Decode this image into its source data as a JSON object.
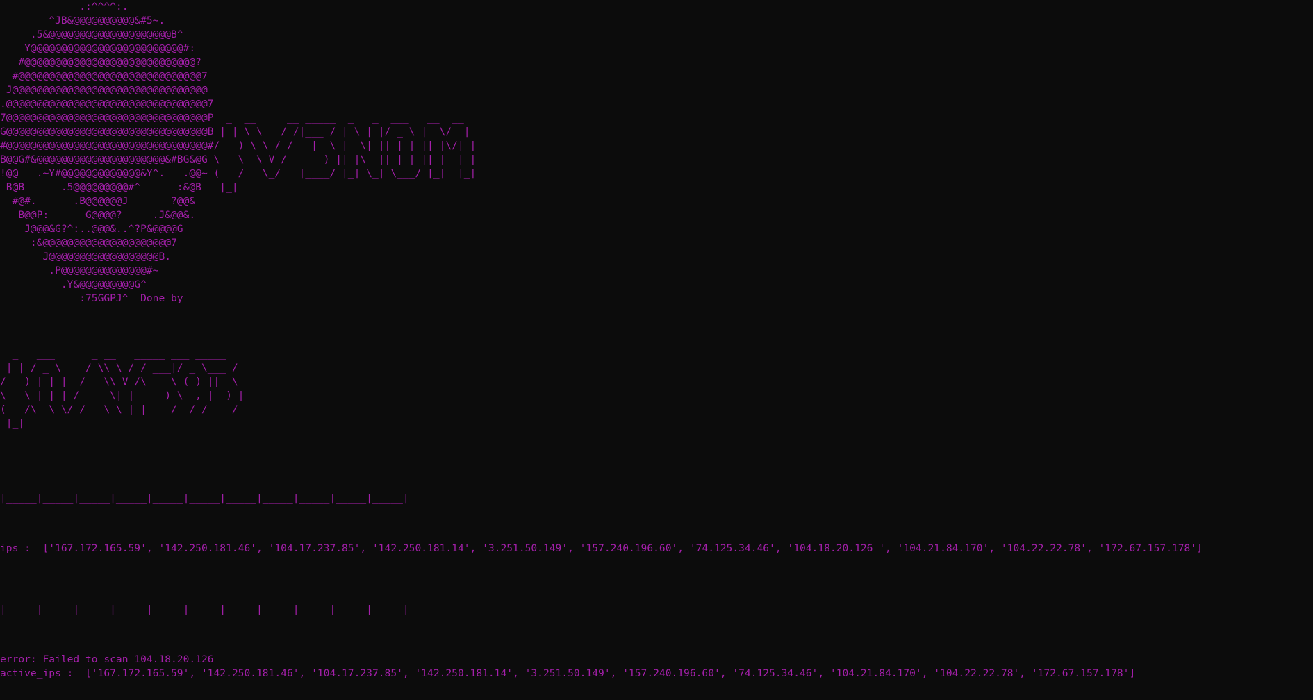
{
  "terminal": {
    "banner_art": "             .:^^^^:.\n        ^JB&@@@@@@@@@@&#5~.\n     .5&@@@@@@@@@@@@@@@@@@@@B^\n    Y@@@@@@@@@@@@@@@@@@@@@@@@@#:\n   #@@@@@@@@@@@@@@@@@@@@@@@@@@@@?\n  #@@@@@@@@@@@@@@@@@@@@@@@@@@@@@@7\n J@@@@@@@@@@@@@@@@@@@@@@@@@@@@@@@@\n.@@@@@@@@@@@@@@@@@@@@@@@@@@@@@@@@@7\n7@@@@@@@@@@@@@@@@@@@@@@@@@@@@@@@@@P\nG@@@@@@@@@@@@@@@@@@@@@@@@@@@@@@@@@B\n#@@@@@@@@@@@@@@@@@@@@@@@@@@@@@@@@@#\nB@@G#&@@@@@@@@@@@@@@@@@@@@@&#BG&@G\n!@@   .~Y#@@@@@@@@@@@@@&Y^.   .@@~\n B@B      .5@@@@@@@@@#^      :&@B\n  #@#.      .B@@@@@@J       ?@@&\n   B@@P:      G@@@@?     .J&@@&.\n    J@@@&G?^:..@@@&..^?P&@@@@G\n     :&@@@@@@@@@@@@@@@@@@@@@7\n       J@@@@@@@@@@@@@@@@@@B.\n        .P@@@@@@@@@@@@@@#~\n          .Y&@@@@@@@@@G^\n             :75GGPJ^  Done by",
    "title_art": "                                     _  __     __ _____  _   _  ___   __  __\n                                    | | \\ \\   / /|___ / | \\ | |/ _ \\ |  \\/  |\n                                   / __) \\ \\ / /   |_ \\ |  \\| || | | || |\\/| |\n                                   \\__ \\  \\ V /   ___) || |\\  || |_| || |  | |\n                                   (   /   \\_/   |____/ |_| \\_| \\___/ |_|  |_|\n                                    |_|",
    "author_art": "  _   ___      _ __   _____ ___ _____\n | | / _ \\    / \\\\ \\ / / ___|/ _ \\___ /\n/ __) | | |  / _ \\\\ V /\\___ \\ (_) ||_ \\\n\\__ \\ |_| | / ___ \\| |  ___) \\__, |__) |\n(   /\\__\\_\\/_/   \\_\\_| |____/  /_/____/\n |_|",
    "divider_1": " _____ _____ _____ _____ _____ _____ _____ _____ _____ _____ _____\n|_____|_____|_____|_____|_____|_____|_____|_____|_____|_____|_____|",
    "ips_line": "ips :  ['167.172.165.59', '142.250.181.46', '104.17.237.85', '142.250.181.14', '3.251.50.149', '157.240.196.60', '74.125.34.46', '104.18.20.126 ', '104.21.84.170', '104.22.22.78', '172.67.157.178']",
    "divider_2": " _____ _____ _____ _____ _____ _____ _____ _____ _____ _____ _____\n|_____|_____|_____|_____|_____|_____|_____|_____|_____|_____|_____|",
    "error_line": "error: Failed to scan 104.18.20.126",
    "active_ips_line": "active_ips :  ['167.172.165.59', '142.250.181.46', '104.17.237.85', '142.250.181.14', '3.251.50.149', '157.240.196.60', '74.125.34.46', '104.21.84.170', '104.22.22.78', '172.67.157.178']"
  },
  "colors": {
    "background": "#0c0c0c",
    "text": "#a31fa9"
  }
}
